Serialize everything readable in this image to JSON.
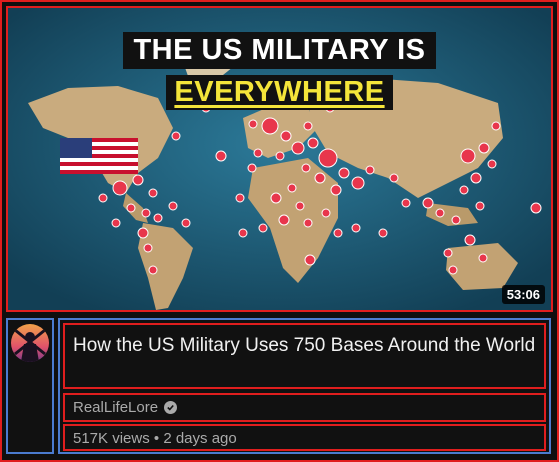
{
  "thumbnail": {
    "title_line1": "THE US MILITARY IS",
    "title_line2": "EVERYWHERE",
    "duration": "53:06"
  },
  "video": {
    "title": "How the US Military Uses 750 Bases Around the World",
    "channel": "RealLifeLore",
    "views": "517K views",
    "separator": "•",
    "age": "2 days ago"
  },
  "colors": {
    "highlight_border": "#e01e1e",
    "group_border": "#4b7bd0",
    "title_yellow": "#f4e53a",
    "ocean": "#1d5e7a",
    "land": "#c9ab7e",
    "pin": "#e8364c"
  },
  "icons": [
    "verified-badge-icon",
    "channel-avatar-icon",
    "us-flag-icon",
    "map-pin-icon"
  ]
}
